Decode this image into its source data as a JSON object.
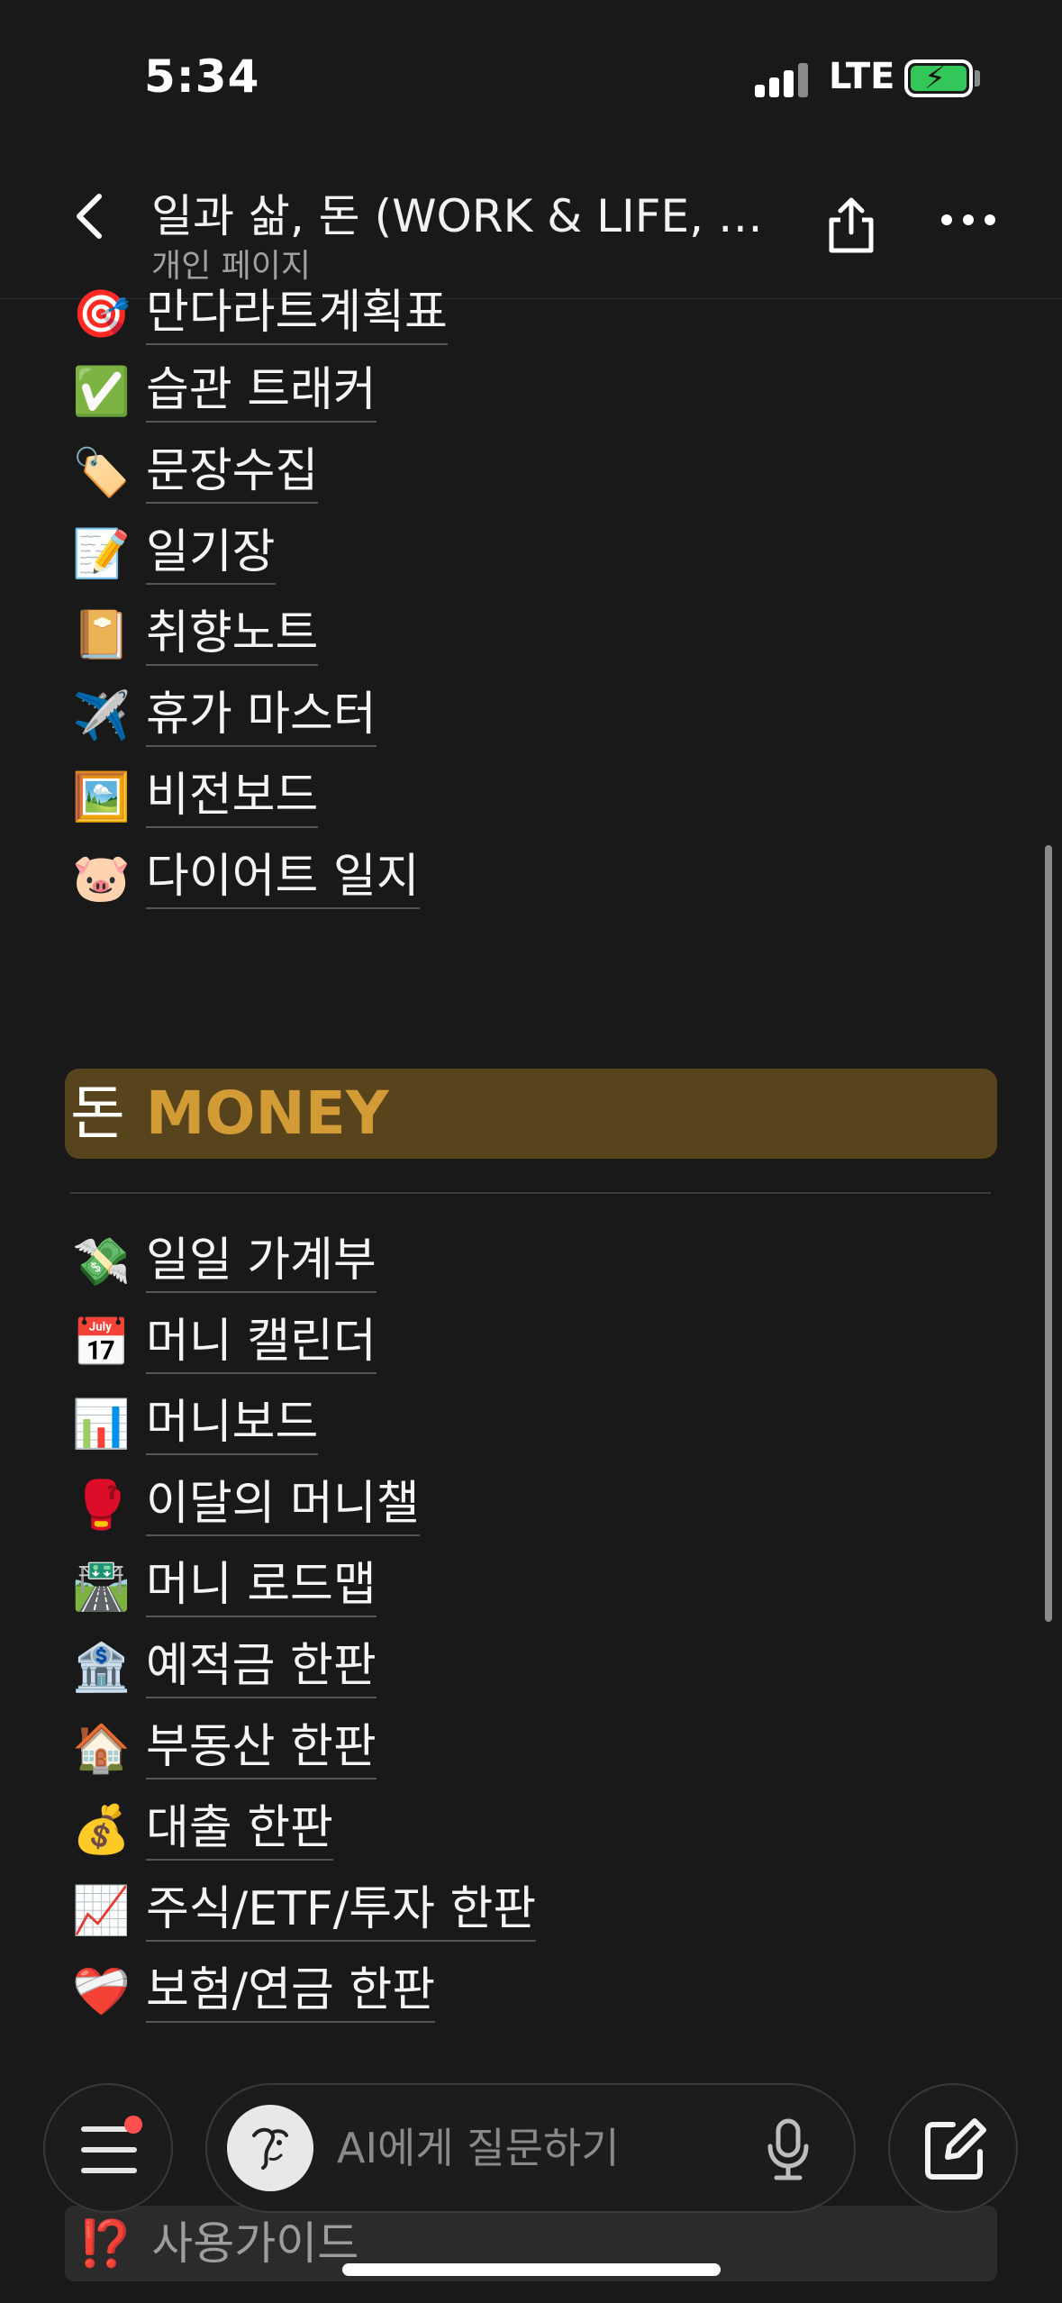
{
  "status_bar": {
    "time": "5:34",
    "network": "LTE"
  },
  "nav": {
    "title": "일과 삶, 돈 (WORK & LIFE, M...",
    "subtitle": "개인 페이지"
  },
  "life_items": [
    {
      "emoji": "🎯",
      "label": "만다라트계획표"
    },
    {
      "emoji": "✅",
      "label": "습관 트래커"
    },
    {
      "emoji": "🏷️",
      "label": "문장수집"
    },
    {
      "emoji": "📝",
      "label": "일기장"
    },
    {
      "emoji": "📔",
      "label": "취향노트"
    },
    {
      "emoji": "✈️",
      "label": "휴가 마스터"
    },
    {
      "emoji": "🖼️",
      "label": "비전보드"
    },
    {
      "emoji": "🐷",
      "label": "다이어트 일지"
    }
  ],
  "money_section": {
    "ko": "돈",
    "en": "MONEY",
    "accent_color": "#d39b35",
    "band_color": "#57431c"
  },
  "money_items": [
    {
      "emoji": "💸",
      "label": "일일 가계부"
    },
    {
      "emoji": "📅",
      "label": "머니 캘린더"
    },
    {
      "emoji": "📊",
      "label": "머니보드"
    },
    {
      "emoji": "🥊",
      "label": "이달의 머니챌"
    },
    {
      "emoji": "🛣️",
      "label": "머니 로드맵"
    },
    {
      "emoji": "🏦",
      "label": "예적금 한판"
    },
    {
      "emoji": "🏠",
      "label": "부동산 한판"
    },
    {
      "emoji": "💰",
      "label": "대출 한판"
    },
    {
      "emoji": "📈",
      "label": "주식/ETF/투자 한판"
    },
    {
      "emoji": "❤️‍🩹",
      "label": "보험/연금 한판"
    }
  ],
  "guide": {
    "emoji": "⁉️",
    "label": "사용가이드"
  },
  "bottom_bar": {
    "ai_placeholder": "AI에게 질문하기"
  }
}
